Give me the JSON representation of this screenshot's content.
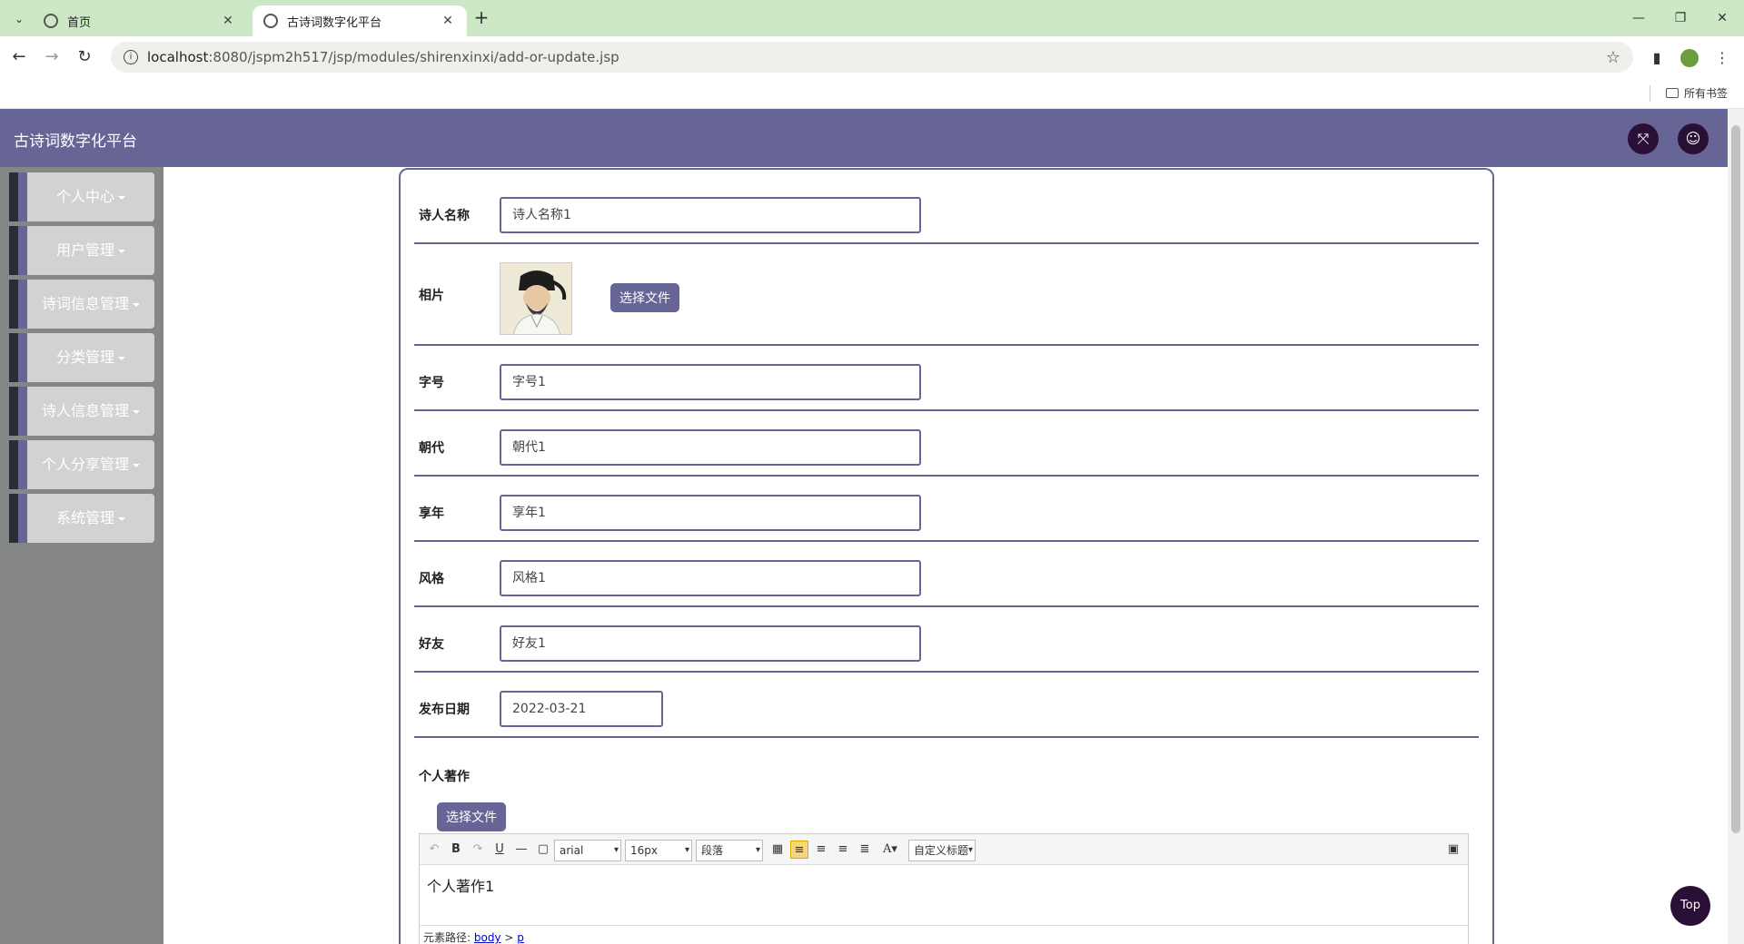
{
  "browser": {
    "tabs": [
      {
        "title": "首页"
      },
      {
        "title": "古诗词数字化平台"
      }
    ],
    "url_host": "localhost",
    "url_path": ":8080/jspm2h517/jsp/modules/shirenxinxi/add-or-update.jsp",
    "bookmarks_label": "所有书签"
  },
  "app": {
    "title": "古诗词数字化平台",
    "accent_color": "#676596",
    "dark_color": "#2a0f36"
  },
  "sidebar": {
    "items": [
      {
        "label": "个人中心"
      },
      {
        "label": "用户管理"
      },
      {
        "label": "诗词信息管理"
      },
      {
        "label": "分类管理"
      },
      {
        "label": "诗人信息管理"
      },
      {
        "label": "个人分享管理"
      },
      {
        "label": "系统管理"
      }
    ]
  },
  "form": {
    "poet_name": {
      "label": "诗人名称",
      "value": "诗人名称1"
    },
    "photo": {
      "label": "相片",
      "button": "选择文件"
    },
    "courtesy": {
      "label": "字号",
      "value": "字号1"
    },
    "dynasty": {
      "label": "朝代",
      "value": "朝代1"
    },
    "lifespan": {
      "label": "享年",
      "value": "享年1"
    },
    "style": {
      "label": "风格",
      "value": "风格1"
    },
    "friends": {
      "label": "好友",
      "value": "好友1"
    },
    "publish_date": {
      "label": "发布日期",
      "value": "2022-03-21"
    },
    "works": {
      "label": "个人著作",
      "button": "选择文件"
    }
  },
  "editor": {
    "font_family": "arial",
    "font_size": "16px",
    "paragraph": "段落",
    "custom_heading": "自定义标题",
    "content": "个人著作1",
    "path_label": "元素路径:",
    "path_body": "body",
    "path_sep": ">",
    "path_p": "p"
  },
  "top_button": "Top"
}
